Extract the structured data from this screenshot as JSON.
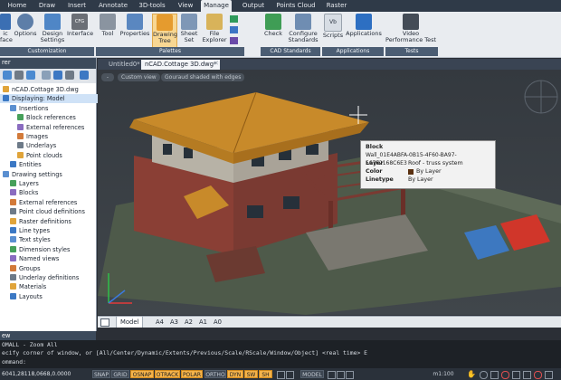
{
  "colors": {
    "accent": "#f5b34a",
    "ribbon_dark": "#2f3a48",
    "ribbon_light": "#e9ecf0",
    "roof": "#c88a2a",
    "tooltip_swatch": "#5a3010"
  },
  "ribbon": {
    "tabs": [
      "Home",
      "Draw",
      "Insert",
      "Annotate",
      "3D-tools",
      "View",
      "Manage",
      "Output",
      "Points Cloud",
      "Raster"
    ],
    "active_tab": "Manage",
    "buttons": [
      {
        "label": "ic\nface",
        "icon": "interface-app-icon"
      },
      {
        "label": "Options",
        "icon": "options-icon"
      },
      {
        "label": "Design\nSettings",
        "icon": "design-settings-icon"
      },
      {
        "label": "Interface",
        "icon": "cfg-interface-icon"
      },
      {
        "label": "Tool",
        "icon": "tool-icon"
      },
      {
        "label": "Properties",
        "icon": "properties-icon"
      },
      {
        "label": "Drawing\nTree",
        "icon": "drawing-tree-icon"
      },
      {
        "label": "Sheet\nSet",
        "icon": "sheet-set-icon"
      },
      {
        "label": "File\nExplorer",
        "icon": "file-explorer-icon"
      },
      {
        "label": "Check",
        "icon": "check-icon"
      },
      {
        "label": "Configure\nStandards",
        "icon": "configure-standards-icon"
      },
      {
        "label": "Scripts",
        "icon": "scripts-icon"
      },
      {
        "label": "Applications",
        "icon": "applications-icon"
      },
      {
        "label": "Video\nPerformance Test",
        "icon": "video-performance-icon"
      }
    ],
    "cfg_icon_text": "CFG",
    "scripts_icon_text": "Vb",
    "groups": [
      "Customization",
      "Palettes",
      "CAD Standards",
      "Applications",
      "Tests"
    ]
  },
  "left_panel": {
    "title": "rer",
    "tree": [
      {
        "label": "nCAD.Cottage 3D.dwg",
        "indent": 0
      },
      {
        "label": "Displaying: Model",
        "indent": 0
      },
      {
        "label": "Insertions",
        "indent": 1
      },
      {
        "label": "Block references",
        "indent": 2
      },
      {
        "label": "External references",
        "indent": 2
      },
      {
        "label": "Images",
        "indent": 2
      },
      {
        "label": "Underlays",
        "indent": 2
      },
      {
        "label": "Point clouds",
        "indent": 2
      },
      {
        "label": "Entities",
        "indent": 1
      },
      {
        "label": "Drawing settings",
        "indent": 0
      },
      {
        "label": "Layers",
        "indent": 1
      },
      {
        "label": "Blocks",
        "indent": 1
      },
      {
        "label": "External references",
        "indent": 1
      },
      {
        "label": "Point cloud definitions",
        "indent": 1
      },
      {
        "label": "Raster definitions",
        "indent": 1
      },
      {
        "label": "Line types",
        "indent": 1
      },
      {
        "label": "Text styles",
        "indent": 1
      },
      {
        "label": "Dimension styles",
        "indent": 1
      },
      {
        "label": "Named views",
        "indent": 1
      },
      {
        "label": "Groups",
        "indent": 1
      },
      {
        "label": "Underlay definitions",
        "indent": 1
      },
      {
        "label": "Materials",
        "indent": 1
      },
      {
        "label": "Layouts",
        "indent": 1
      }
    ]
  },
  "documents": {
    "tabs": [
      "Untitled0*",
      "nCAD.Cottage 3D.dwg*"
    ],
    "active": 1
  },
  "viewport": {
    "view": "Custom view",
    "style": "Gouraud shaded with edges",
    "minus": "-"
  },
  "tooltip": {
    "title": "Block",
    "handle": "Wall_01E4ABFA-0B15-4F60-BA97-567F2168C6E3",
    "rows": [
      {
        "key": "Layer",
        "value": "Roof - truss system"
      },
      {
        "key": "Color",
        "value": "By Layer"
      },
      {
        "key": "Linetype",
        "value": "By Layer"
      }
    ]
  },
  "layout_tabs": [
    "Model",
    "A4",
    "A3",
    "A2",
    "A1",
    "A0"
  ],
  "command": {
    "header": "ew",
    "lines": [
      "OMALL - Zoom All",
      "ecify corner of window, or [All/Center/Dynamic/Extents/Previous/Scale/RScale/Window/Object] <real time> E",
      "ommand:"
    ]
  },
  "status": {
    "coords": "6041,28118,0668,0.0000",
    "toggles": [
      {
        "label": "SNAP",
        "on": false
      },
      {
        "label": "GRID",
        "on": false
      },
      {
        "label": "OSNAP",
        "on": true
      },
      {
        "label": "OTRACK",
        "on": true
      },
      {
        "label": "POLAR",
        "on": true
      },
      {
        "label": "ORTHO",
        "on": false
      },
      {
        "label": "DYN",
        "on": true
      },
      {
        "label": "SW",
        "on": true
      },
      {
        "label": "SH",
        "on": true
      }
    ],
    "space": "MODEL",
    "scale": "m1:100"
  }
}
